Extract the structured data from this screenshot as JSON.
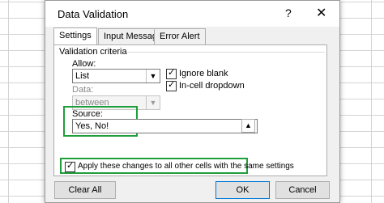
{
  "dialog": {
    "title": "Data Validation",
    "help_glyph": "?",
    "close_glyph": "✕",
    "tabs": [
      {
        "label": "Settings"
      },
      {
        "label": "Input Message"
      },
      {
        "label": "Error Alert"
      }
    ]
  },
  "settings": {
    "group_label": "Validation criteria",
    "allow_label": "Allow:",
    "allow_value": "List",
    "data_label": "Data:",
    "data_value": "between",
    "ignore_blank_label": "Ignore blank",
    "ignore_blank_checked": true,
    "in_cell_dropdown_label": "In-cell dropdown",
    "in_cell_dropdown_checked": true,
    "source_label": "Source:",
    "source_value": "Yes, No!",
    "apply_label": "Apply these changes to all other cells with the same settings",
    "apply_checked": true
  },
  "buttons": {
    "clear_all": "Clear All",
    "ok": "OK",
    "cancel": "Cancel"
  },
  "colors": {
    "highlight_border": "#1f9e3c",
    "primary_button_border": "#0078d7"
  },
  "icons": {
    "collapse_dialog": "range-selector-icon",
    "dropdown": "chevron-down-icon"
  }
}
